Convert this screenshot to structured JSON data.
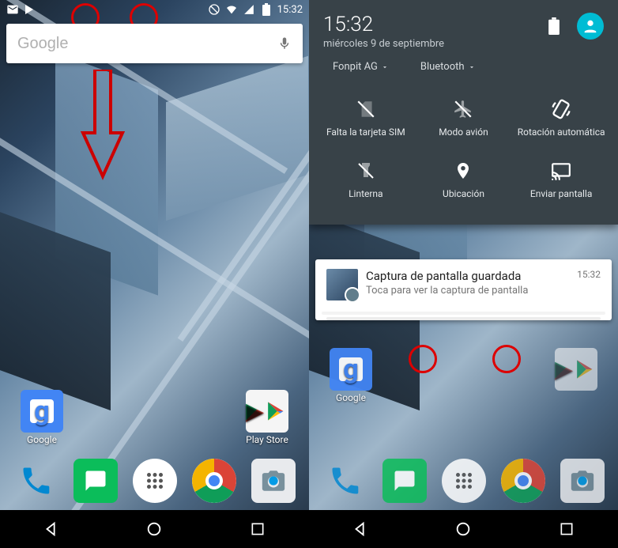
{
  "status": {
    "left_icons": [
      "gmail-icon",
      "play-store-icon"
    ],
    "right_icons": [
      "no-circle-icon",
      "wifi-icon",
      "signal-icon",
      "battery-icon"
    ],
    "time": "15:32"
  },
  "search": {
    "placeholder": "Google",
    "mic": "mic-icon"
  },
  "apps": {
    "google_label": "Google",
    "playstore_label": "Play Store"
  },
  "dock": {
    "phone": "phone-icon",
    "messages": "messages-icon",
    "drawer": "app-drawer-icon",
    "chrome": "chrome-icon",
    "camera": "camera-icon"
  },
  "nav": {
    "back": "back-icon",
    "home": "home-icon",
    "recents": "recents-icon"
  },
  "qs": {
    "time": "15:32",
    "date": "miércoles 9 de septiembre",
    "wifi_label": "Fonpit AG",
    "bt_label": "Bluetooth",
    "tiles": [
      {
        "icon": "no-sim-icon",
        "label": "Falta la tarjeta SIM"
      },
      {
        "icon": "airplane-icon",
        "label": "Modo avión"
      },
      {
        "icon": "autorotate-icon",
        "label": "Rotación automática"
      },
      {
        "icon": "flashlight-icon",
        "label": "Linterna"
      },
      {
        "icon": "location-icon",
        "label": "Ubicación"
      },
      {
        "icon": "cast-icon",
        "label": "Enviar pantalla"
      }
    ],
    "battery_icon": "battery-icon",
    "avatar_icon": "user-avatar"
  },
  "notification": {
    "title": "Captura de pantalla guardada",
    "subtitle": "Toca para ver la captura de pantalla",
    "time": "15:32"
  },
  "annotation": {
    "circles": [
      "c1",
      "c2",
      "c3",
      "c4"
    ],
    "arrow": "down-arrow"
  },
  "colors": {
    "accent": "#00bcd4",
    "annotation": "#d00000",
    "qs_bg": "#384248"
  }
}
